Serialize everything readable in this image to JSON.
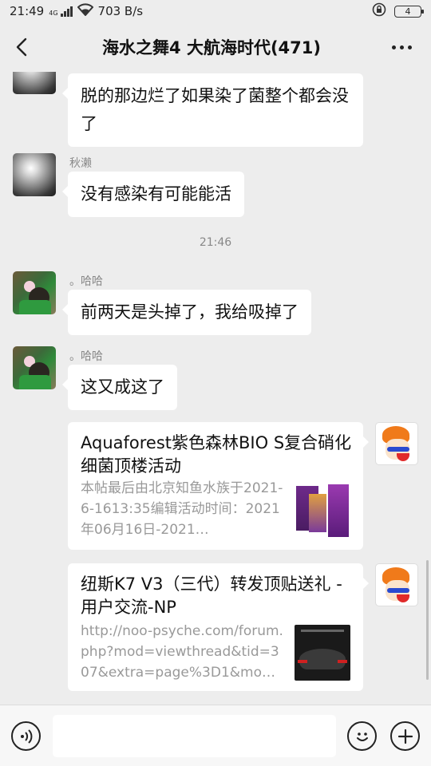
{
  "status_bar": {
    "time": "21:49",
    "network_badge": "4G",
    "speed": "703 B/s",
    "battery": "4"
  },
  "header": {
    "title": "海水之舞4 大航海时代(471)"
  },
  "messages": [
    {
      "sender": "",
      "text": "脱的那边烂了如果染了菌整个都会没了"
    },
    {
      "sender": "秋濑",
      "text": "没有感染有可能能活"
    },
    {
      "timestamp": "21:46"
    },
    {
      "sender": "。哈哈",
      "text": "前两天是头掉了，我给吸掉了"
    },
    {
      "sender": "。哈哈",
      "text": "这又成这了"
    }
  ],
  "cards": [
    {
      "title": "Aquaforest紫色森林BIO S复合硝化细菌顶楼活动",
      "description": "本帖最后由北京知鱼水族于2021-6-1613:35编辑活动时间：2021年06月16日-2021…"
    },
    {
      "title": "纽斯K7 V3（三代）转发顶贴送礼 - 用户交流-NP",
      "description": "http://noo-psyche.com/forum.php?mod=viewthread&tid=307&extra=page%3D1&mo…"
    }
  ],
  "input": {
    "value": "",
    "placeholder": ""
  },
  "icons": {
    "back": "back-arrow-icon",
    "more": "more-dots-icon",
    "voice": "voice-icon",
    "emoji": "emoji-icon",
    "plus": "plus-icon"
  },
  "colors": {
    "background": "#ededed",
    "bubble": "#ffffff",
    "meta_text": "#888888",
    "card_desc": "#999999"
  }
}
